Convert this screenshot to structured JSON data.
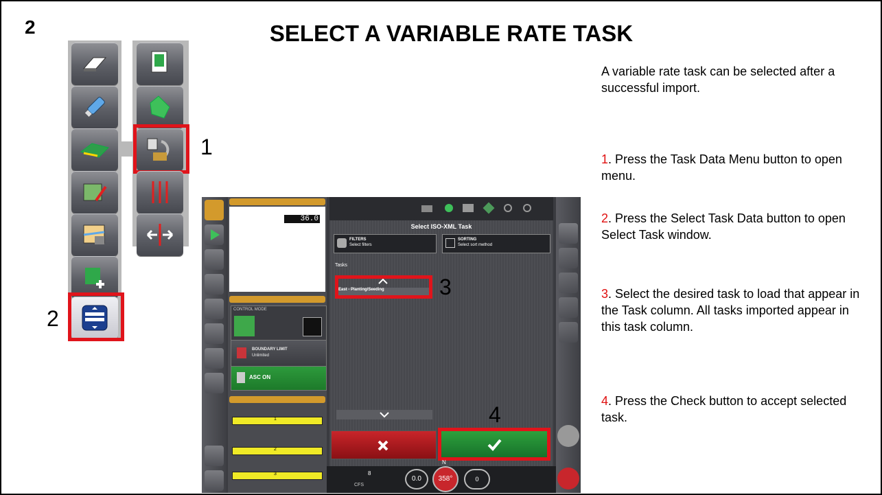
{
  "slide_number": "2",
  "title": "SELECT A VARIABLE RATE TASK",
  "instructions": {
    "heading": "A variable rate task can be selected after a successful import.",
    "steps": [
      {
        "num": "1",
        "text": ". Press the Task Data Menu button to open menu."
      },
      {
        "num": "2",
        "text": ". Press the Select Task Data button to open Select Task window."
      },
      {
        "num": "3",
        "text": ". Select the desired task to load that appear in the Task column. All tasks imported appear in this task column."
      },
      {
        "num": "4",
        "text": ". Press the Check button to accept selected task."
      }
    ]
  },
  "callouts": {
    "c1": "1",
    "c2": "2",
    "c3": "3",
    "c4": "4"
  },
  "dialog": {
    "title": "Select ISO-XML Task",
    "filters_label": "FILTERS",
    "filters_value": "Select filters",
    "sorting_label": "SORTING",
    "sorting_value": "Select sort method",
    "tasks_label": "Tasks",
    "task_item": "East - Planting/Seeding"
  },
  "left_panel": {
    "control_mode": "CONTROL MODE",
    "boundary_label": "BOUNDARY LIMIT",
    "boundary_value": "Unlimited",
    "asc": "ASC ON",
    "speed": "36.0",
    "bar_values": [
      "1",
      "2",
      "3"
    ]
  },
  "status_bar": {
    "speed": "0.0",
    "heading": "358°",
    "north": "N",
    "sat": "8",
    "cfs": "CFS",
    "rate_value": "0"
  },
  "colors": {
    "highlight": "#e0141b",
    "accent_red": "#e01010",
    "confirm": "#1f8a2e",
    "cancel": "#b1161b"
  }
}
